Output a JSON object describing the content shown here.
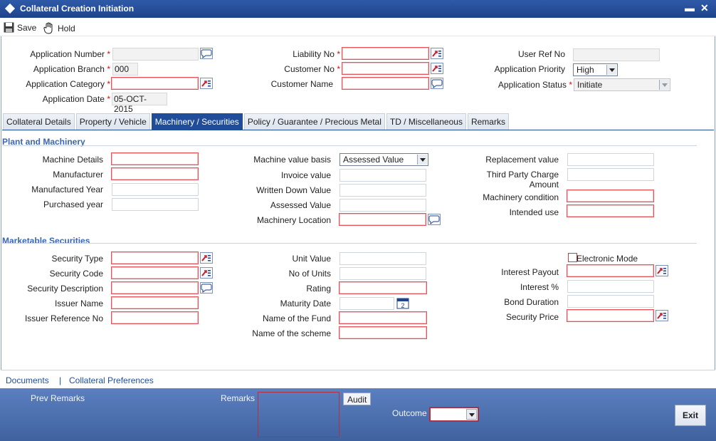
{
  "window": {
    "title": "Collateral Creation Initiation",
    "minimize": "▬",
    "close": "✕"
  },
  "toolbar": {
    "save_label": "Save",
    "hold_label": "Hold"
  },
  "header": {
    "application_number_label": "Application Number",
    "application_branch_label": "Application Branch",
    "application_branch_value": "000",
    "application_category_label": "Application Category",
    "application_date_label": "Application Date",
    "application_date_value": "05-OCT-2015",
    "liability_no_label": "Liability No",
    "customer_no_label": "Customer No",
    "customer_name_label": "Customer Name",
    "user_ref_no_label": "User Ref No",
    "application_priority_label": "Application Priority",
    "application_priority_value": "High",
    "application_status_label": "Application Status",
    "application_status_value": "Initiate",
    "required_marker": "*"
  },
  "tabs": [
    {
      "label": "Collateral Details"
    },
    {
      "label": "Property / Vehicle"
    },
    {
      "label": "Machinery / Securities"
    },
    {
      "label": "Policy / Guarantee / Precious Metal"
    },
    {
      "label": "TD / Miscellaneous"
    },
    {
      "label": "Remarks"
    }
  ],
  "active_tab": "Machinery / Securities",
  "plant": {
    "section_title": "Plant and Machinery",
    "machine_details_label": "Machine Details",
    "manufacturer_label": "Manufacturer",
    "manufactured_year_label": "Manufactured Year",
    "purchased_year_label": "Purchased year",
    "machine_value_basis_label": "Machine value basis",
    "machine_value_basis_value": "Assessed Value",
    "invoice_value_label": "Invoice value",
    "written_down_value_label": "Written Down Value",
    "assessed_value_label": "Assessed Value",
    "machinery_location_label": "Machinery Location",
    "replacement_value_label": "Replacement value",
    "third_party_charge_label_1": "Third Party Charge",
    "third_party_charge_label_2": "Amount",
    "machinery_condition_label": "Machinery condition",
    "intended_use_label": "Intended use"
  },
  "securities": {
    "section_title": "Marketable Securities",
    "security_type_label": "Security Type",
    "security_code_label": "Security Code",
    "security_description_label": "Security Description",
    "issuer_name_label": "Issuer Name",
    "issuer_reference_no_label": "Issuer Reference No",
    "unit_value_label": "Unit Value",
    "no_of_units_label": "No of Units",
    "rating_label": "Rating",
    "maturity_date_label": "Maturity Date",
    "name_of_fund_label": "Name of the Fund",
    "name_of_scheme_label": "Name of the scheme",
    "electronic_mode_label": "Electronic Mode",
    "interest_payout_label": "Interest Payout",
    "interest_pct_label": "Interest %",
    "bond_duration_label": "Bond Duration",
    "security_price_label": "Security Price"
  },
  "footer_links": {
    "documents": "Documents",
    "separator": "|",
    "preferences": "Collateral Preferences"
  },
  "bottom": {
    "prev_remarks_label": "Prev Remarks",
    "remarks_label": "Remarks",
    "audit_label": "Audit",
    "outcome_label": "Outcome",
    "exit_label": "Exit"
  },
  "colors": {
    "titlebar": "#1e438c",
    "active_tab": "#1f4d9a",
    "mandatory_border": "#e2545a",
    "section_title": "#3a66b3",
    "bottom_bar": "#4b6fae"
  }
}
